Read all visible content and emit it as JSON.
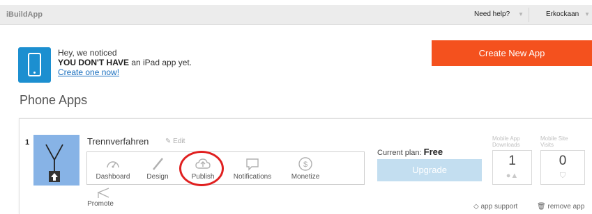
{
  "topbar": {
    "brand": "iBuildApp",
    "need_help": "Need help?",
    "user": "Erkockaan"
  },
  "notice": {
    "line1": "Hey, we noticed",
    "strong": "YOU DON'T HAVE",
    "line2_rest": " an iPad app yet.",
    "link": "Create one now!"
  },
  "create_button": "Create New App",
  "section_title": "Phone Apps",
  "app": {
    "number": "1",
    "name": "Trennverfahren",
    "edit": "Edit",
    "nav": [
      {
        "label": "Dashboard",
        "icon": "dashboard-icon"
      },
      {
        "label": "Design",
        "icon": "brush-icon"
      },
      {
        "label": "Publish",
        "icon": "cloud-upload-icon"
      },
      {
        "label": "Notifications",
        "icon": "chat-bubble-icon"
      },
      {
        "label": "Monetize",
        "icon": "dollar-icon"
      }
    ],
    "promote": "Promote",
    "plan_label": "Current plan: ",
    "plan_value": "Free",
    "upgrade": "Upgrade",
    "stats": [
      {
        "label": "Mobile App Downloads",
        "value": "1",
        "icons": "apple-android-icons"
      },
      {
        "label": "Mobile Site Visits",
        "value": "0",
        "icons": "html5-icon"
      }
    ],
    "app_support": "app support",
    "remove_app": "remove app"
  },
  "colors": {
    "accent_orange": "#f4511e",
    "ipad_blue": "#1c8fd0",
    "upgrade_blue": "#c3def0",
    "highlight_red": "#e02020"
  }
}
